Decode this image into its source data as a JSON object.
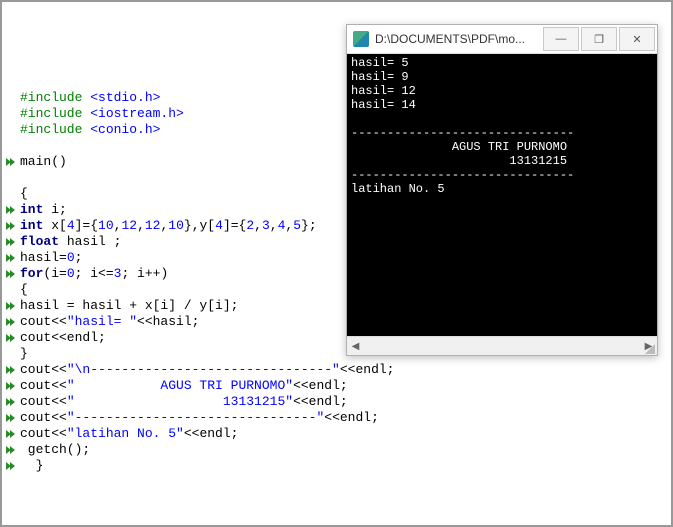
{
  "code": {
    "lines": [
      {
        "gutter": false,
        "tokens": []
      },
      {
        "gutter": false,
        "tokens": []
      },
      {
        "gutter": false,
        "tokens": []
      },
      {
        "gutter": false,
        "tokens": []
      },
      {
        "gutter": false,
        "tokens": []
      },
      {
        "gutter": false,
        "tokens": [
          {
            "cls": "dir",
            "t": "#include "
          },
          {
            "cls": "hdr",
            "t": "<stdio.h>"
          }
        ]
      },
      {
        "gutter": false,
        "tokens": [
          {
            "cls": "dir",
            "t": "#include "
          },
          {
            "cls": "hdr",
            "t": "<iostream.h>"
          }
        ]
      },
      {
        "gutter": false,
        "tokens": [
          {
            "cls": "dir",
            "t": "#include "
          },
          {
            "cls": "hdr",
            "t": "<conio.h>"
          }
        ]
      },
      {
        "gutter": false,
        "tokens": []
      },
      {
        "gutter": true,
        "tokens": [
          {
            "cls": "plain",
            "t": "main()"
          }
        ]
      },
      {
        "gutter": false,
        "tokens": []
      },
      {
        "gutter": false,
        "tokens": [
          {
            "cls": "plain",
            "t": "{"
          }
        ]
      },
      {
        "gutter": true,
        "tokens": [
          {
            "cls": "kw",
            "t": "int"
          },
          {
            "cls": "plain",
            "t": " i;"
          }
        ]
      },
      {
        "gutter": true,
        "tokens": [
          {
            "cls": "kw",
            "t": "int"
          },
          {
            "cls": "plain",
            "t": " x["
          },
          {
            "cls": "num",
            "t": "4"
          },
          {
            "cls": "plain",
            "t": "]={"
          },
          {
            "cls": "num",
            "t": "10"
          },
          {
            "cls": "plain",
            "t": ","
          },
          {
            "cls": "num",
            "t": "12"
          },
          {
            "cls": "plain",
            "t": ","
          },
          {
            "cls": "num",
            "t": "12"
          },
          {
            "cls": "plain",
            "t": ","
          },
          {
            "cls": "num",
            "t": "10"
          },
          {
            "cls": "plain",
            "t": "},y["
          },
          {
            "cls": "num",
            "t": "4"
          },
          {
            "cls": "plain",
            "t": "]={"
          },
          {
            "cls": "num",
            "t": "2"
          },
          {
            "cls": "plain",
            "t": ","
          },
          {
            "cls": "num",
            "t": "3"
          },
          {
            "cls": "plain",
            "t": ","
          },
          {
            "cls": "num",
            "t": "4"
          },
          {
            "cls": "plain",
            "t": ","
          },
          {
            "cls": "num",
            "t": "5"
          },
          {
            "cls": "plain",
            "t": "};"
          }
        ]
      },
      {
        "gutter": true,
        "tokens": [
          {
            "cls": "kw",
            "t": "float"
          },
          {
            "cls": "plain",
            "t": " hasil ;"
          }
        ]
      },
      {
        "gutter": true,
        "tokens": [
          {
            "cls": "plain",
            "t": "hasil="
          },
          {
            "cls": "num",
            "t": "0"
          },
          {
            "cls": "plain",
            "t": ";"
          }
        ]
      },
      {
        "gutter": true,
        "tokens": [
          {
            "cls": "kw",
            "t": "for"
          },
          {
            "cls": "plain",
            "t": "(i="
          },
          {
            "cls": "num",
            "t": "0"
          },
          {
            "cls": "plain",
            "t": "; i<="
          },
          {
            "cls": "num",
            "t": "3"
          },
          {
            "cls": "plain",
            "t": "; i++)"
          }
        ]
      },
      {
        "gutter": false,
        "tokens": [
          {
            "cls": "plain",
            "t": "{"
          }
        ]
      },
      {
        "gutter": true,
        "tokens": [
          {
            "cls": "plain",
            "t": "hasil = hasil + x[i] / y[i];"
          }
        ]
      },
      {
        "gutter": true,
        "tokens": [
          {
            "cls": "plain",
            "t": "cout<<"
          },
          {
            "cls": "str",
            "t": "\"hasil= \""
          },
          {
            "cls": "plain",
            "t": "<<hasil;"
          }
        ]
      },
      {
        "gutter": true,
        "tokens": [
          {
            "cls": "plain",
            "t": "cout<<endl;"
          }
        ]
      },
      {
        "gutter": false,
        "tokens": [
          {
            "cls": "plain",
            "t": "}"
          }
        ]
      },
      {
        "gutter": true,
        "tokens": [
          {
            "cls": "plain",
            "t": "cout<<"
          },
          {
            "cls": "str",
            "t": "\"\\n-------------------------------\""
          },
          {
            "cls": "plain",
            "t": "<<endl;"
          }
        ]
      },
      {
        "gutter": true,
        "tokens": [
          {
            "cls": "plain",
            "t": "cout<<"
          },
          {
            "cls": "str",
            "t": "\"           AGUS TRI PURNOMO\""
          },
          {
            "cls": "plain",
            "t": "<<endl;"
          }
        ]
      },
      {
        "gutter": true,
        "tokens": [
          {
            "cls": "plain",
            "t": "cout<<"
          },
          {
            "cls": "str",
            "t": "\"                   13131215\""
          },
          {
            "cls": "plain",
            "t": "<<endl;"
          }
        ]
      },
      {
        "gutter": true,
        "tokens": [
          {
            "cls": "plain",
            "t": "cout<<"
          },
          {
            "cls": "str",
            "t": "\"-------------------------------\""
          },
          {
            "cls": "plain",
            "t": "<<endl;"
          }
        ]
      },
      {
        "gutter": true,
        "tokens": [
          {
            "cls": "plain",
            "t": "cout<<"
          },
          {
            "cls": "str",
            "t": "\"latihan No. 5\""
          },
          {
            "cls": "plain",
            "t": "<<endl;"
          }
        ]
      },
      {
        "gutter": true,
        "tokens": [
          {
            "cls": "plain",
            "t": " getch();"
          }
        ]
      },
      {
        "gutter": true,
        "tokens": [
          {
            "cls": "plain",
            "t": "  }"
          }
        ]
      }
    ]
  },
  "console": {
    "title": "D:\\DOCUMENTS\\PDF\\mo...",
    "lines": [
      "hasil= 5",
      "hasil= 9",
      "hasil= 12",
      "hasil= 14",
      "",
      "-------------------------------",
      "              AGUS TRI PURNOMO",
      "                      13131215",
      "-------------------------------",
      "latihan No. 5"
    ]
  },
  "window_controls": {
    "min": "—",
    "max": "❐",
    "close": "✕"
  }
}
